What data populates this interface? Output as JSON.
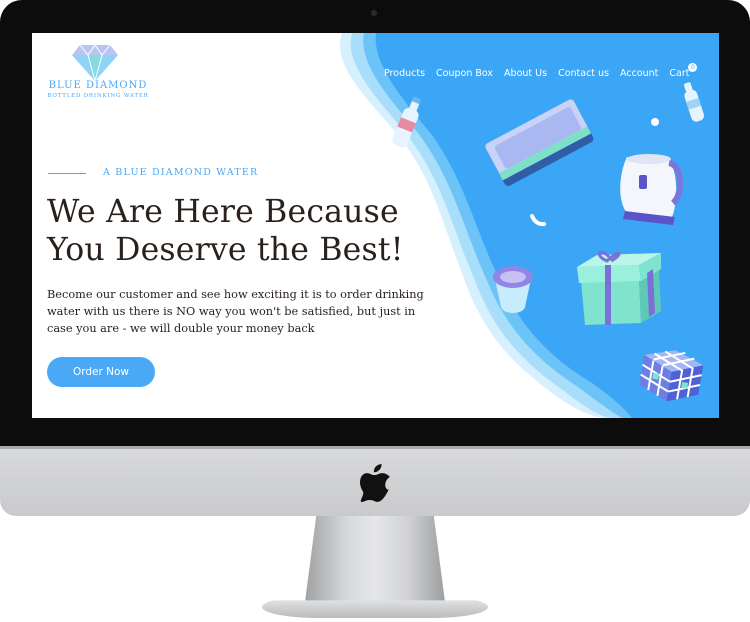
{
  "brand": {
    "name": "BLUE DIAMOND",
    "tagline": "BOTTLED DRINKING WATER"
  },
  "nav": {
    "items": [
      {
        "label": "Products"
      },
      {
        "label": "Coupon Box"
      },
      {
        "label": "About Us"
      },
      {
        "label": "Contact us"
      },
      {
        "label": "Account"
      },
      {
        "label": "Cart"
      }
    ],
    "cart_count": "0"
  },
  "hero": {
    "eyebrow": "A BLUE DIAMOND WATER",
    "headline_line1": "We Are Here Because",
    "headline_line2": "You Deserve the Best!",
    "body": "Become our customer and see how exciting it is to order drinking water with us there is NO way you won't be satisfied, but just in case you are - we will double your money back",
    "cta_label": "Order Now"
  },
  "colors": {
    "accent_blue": "#49a9f6",
    "wave_blue": "#3ba6f6",
    "wave_light": "#bfe6fb",
    "text_dark": "#2a211d",
    "bezel": "#0c0c0c"
  },
  "icons": [
    "diamond-logo-icon",
    "apple-logo-icon",
    "water-bottle-icon",
    "kettle-icon",
    "gift-box-icon",
    "rubiks-cube-icon",
    "cup-icon",
    "book-icon"
  ]
}
